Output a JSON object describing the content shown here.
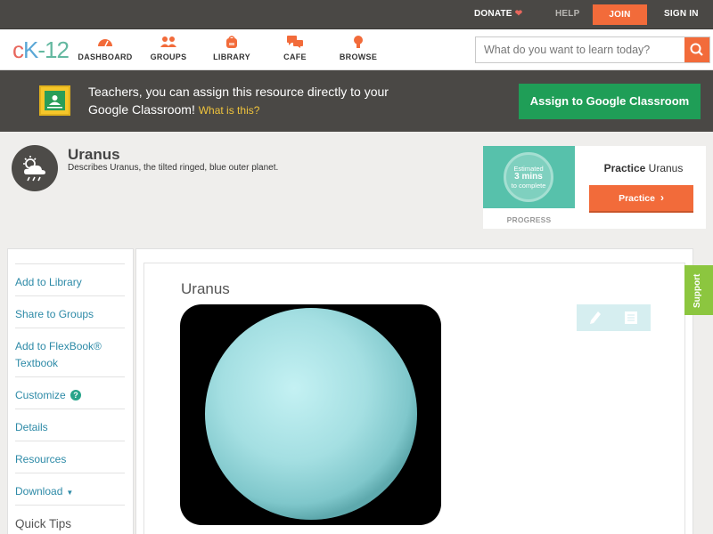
{
  "topbar": {
    "donate": "DONATE",
    "help": "HELP",
    "join": "JOIN",
    "sign_in": "SIGN IN"
  },
  "header": {
    "logo": {
      "c": "c",
      "k": "K",
      "dash_num": "-12"
    },
    "nav": [
      {
        "label": "DASHBOARD",
        "icon": "dashboard-gauge-icon"
      },
      {
        "label": "GROUPS",
        "icon": "groups-people-icon"
      },
      {
        "label": "LIBRARY",
        "icon": "library-backpack-icon"
      },
      {
        "label": "CAFE",
        "icon": "cafe-chat-bubbles-icon"
      },
      {
        "label": "BROWSE",
        "icon": "browse-lightbulb-icon"
      }
    ],
    "search": {
      "placeholder": "What do you want to learn today?",
      "icon": "search-icon"
    }
  },
  "banner": {
    "text": "Teachers, you can assign this resource directly to your Google Classroom!",
    "what_link": "What is this?",
    "assign_button": "Assign to Google Classroom"
  },
  "concept": {
    "title": "Uranus",
    "description": "Describes Uranus, the tilted ringed, blue outer planet.",
    "icon": "weather-cloud-sun-icon"
  },
  "practice": {
    "estimated_line1": "Estimated",
    "estimated_line2": "3 mins",
    "estimated_line3": "to complete",
    "progress_label": "PROGRESS",
    "title_bold": "Practice",
    "title_rest": "Uranus",
    "button": "Practice"
  },
  "sidebar": {
    "items": [
      {
        "label": "Add to Library"
      },
      {
        "label": "Share to Groups"
      },
      {
        "label": "Add to FlexBook® Textbook"
      },
      {
        "label": "Customize"
      },
      {
        "label": "Details"
      },
      {
        "label": "Resources"
      },
      {
        "label": "Download"
      }
    ],
    "quick_tips": "Quick Tips"
  },
  "content": {
    "title": "Uranus"
  },
  "support": "Support",
  "colors": {
    "accent_orange": "#f26b3a",
    "google_green": "#1f9e57",
    "dark_bar": "#4a4845",
    "link_teal": "#2d8aa7",
    "uranus_blue": "#a8e2e4"
  }
}
